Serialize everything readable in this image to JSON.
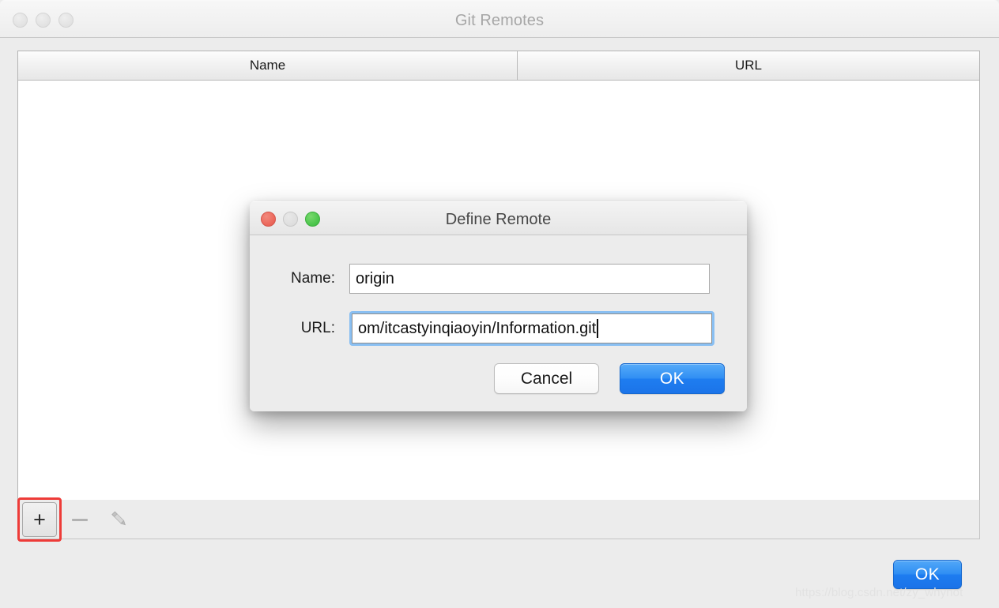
{
  "window": {
    "title": "Git Remotes",
    "traffic_lights": [
      "close-inactive",
      "minimize-inactive",
      "maximize-inactive"
    ]
  },
  "table": {
    "columns": [
      {
        "key": "name",
        "header": "Name"
      },
      {
        "key": "url",
        "header": "URL"
      }
    ],
    "rows": []
  },
  "toolbar": {
    "add_label": "+",
    "add_icon": "plus-icon",
    "remove_icon": "minus-icon",
    "edit_icon": "pencil-icon",
    "add_enabled": true,
    "remove_enabled": false,
    "edit_enabled": false,
    "highlight_color": "#ee3b38"
  },
  "footer": {
    "ok_label": "OK"
  },
  "watermark": {
    "text": "https://blog.csdn.net/zy_whynot"
  },
  "dialog": {
    "title": "Define Remote",
    "fields": {
      "name": {
        "label": "Name:",
        "value": "origin",
        "placeholder": ""
      },
      "url": {
        "label": "URL:",
        "value": "om/itcastyinqiaoyin/Information.git",
        "placeholder": "",
        "focused": true
      }
    },
    "buttons": {
      "cancel_label": "Cancel",
      "ok_label": "OK",
      "default_button": "OK"
    }
  },
  "colors": {
    "accent_blue": "#1e7df0",
    "window_bg": "#ececec",
    "traffic_red": "#ec6a5e",
    "traffic_gray": "#dedede",
    "traffic_green": "#4fc74f",
    "highlight_red": "#ee3b38"
  }
}
